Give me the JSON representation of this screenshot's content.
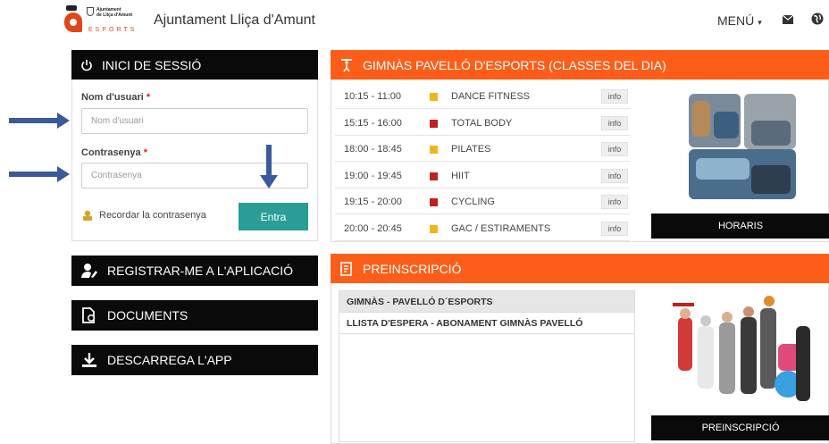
{
  "header": {
    "logo_text_line1": "Ajuntament",
    "logo_text_line2": "de Lliça d'Amunt",
    "logo_esports": "ESPORTS",
    "site_title": "Ajuntament Lliça d'Amunt",
    "menu_label": "MENÚ"
  },
  "login": {
    "title": "INICI DE SESSIÓ",
    "username_label": "Nom d'usuari",
    "username_placeholder": "Nom d'usuari",
    "password_label": "Contrasenya",
    "password_placeholder": "Contrasenya",
    "required_mark": "*",
    "remember_label": "Recordar la contrasenya",
    "enter_button": "Entra"
  },
  "side_buttons": {
    "register": "REGISTRAR-ME A L'APLICACIÓ",
    "documents": "DOCUMENTS",
    "download": "DESCARREGA L'APP"
  },
  "gym": {
    "title": "GIMNÀS PAVELLÓ D'ESPORTS (CLASSES DEL DIA)",
    "classes": [
      {
        "time": "10:15 - 11:00",
        "name": "DANCE FITNESS",
        "color": "#f2b418",
        "info": "info"
      },
      {
        "time": "15:15 - 16:00",
        "name": "TOTAL BODY",
        "color": "#c0211b",
        "info": "info"
      },
      {
        "time": "18:00 - 18:45",
        "name": "PILATES",
        "color": "#f2b418",
        "info": "info"
      },
      {
        "time": "19:00 - 19:45",
        "name": "HIIT",
        "color": "#c0211b",
        "info": "info"
      },
      {
        "time": "19:15 - 20:00",
        "name": "CYCLING",
        "color": "#c0211b",
        "info": "info"
      },
      {
        "time": "20:00 - 20:45",
        "name": "GAC / ESTIRAMENTS",
        "color": "#f2b418",
        "info": "info"
      }
    ],
    "schedule_button": "HORARIS"
  },
  "preinscription": {
    "title": "PREINSCRIPCIÓ",
    "list_header": "GIMNÀS - PAVELLÓ D´ESPORTS",
    "items": [
      "LLISTA D'ESPERA - ABONAMENT GIMNÀS PAVELLÓ"
    ],
    "button": "PREINSCRIPCIÓ"
  },
  "colors": {
    "accent_orange": "#fc5e1a",
    "accent_teal": "#2a9d96",
    "bar_black": "#0a0a0a",
    "annotation_blue": "#3a5a9a"
  }
}
